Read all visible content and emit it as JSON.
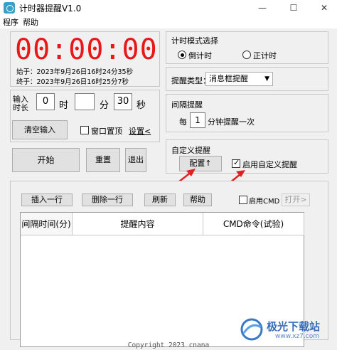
{
  "window": {
    "title": "计时器提醒V1.0",
    "min_glyph": "—",
    "max_glyph": "☐",
    "close_glyph": "✕"
  },
  "menu": {
    "items": [
      "程序",
      "帮助"
    ]
  },
  "clock": {
    "display": "00:00:00",
    "start_line": "始于：2023年9月26日16时24分35秒",
    "end_line": "终于：2023年9月26日16时25分7秒"
  },
  "input": {
    "label_top": "输入",
    "label_bottom": "时长",
    "hours": "0",
    "hours_unit": "时",
    "minutes": "",
    "minutes_unit": "分",
    "seconds": "30",
    "seconds_unit": "秒",
    "clear_label": "清空输入",
    "pin_label": "窗口置顶",
    "settings_link": "设置<"
  },
  "actions": {
    "start": "开始",
    "reset": "重置",
    "exit": "退出"
  },
  "mode": {
    "title": "计时模式选择",
    "countdown": "倒计时",
    "countup": "正计时",
    "countdown_selected": true
  },
  "reminder_type": {
    "label": "提醒类型：",
    "value": "消息框提醒"
  },
  "interval": {
    "title": "间隔提醒",
    "prefix": "每",
    "value": "1",
    "suffix": "分钟提醒一次"
  },
  "custom": {
    "title": "自定义提醒",
    "config_label": "配置↑",
    "enable_label": "启用自定义提醒",
    "enabled": true
  },
  "toolbar": {
    "insert": "插入一行",
    "delete": "删除一行",
    "refresh": "刷新",
    "help": "帮助",
    "enable_cmd": "启用CMD",
    "open": "打开>"
  },
  "table": {
    "columns": [
      "间隔时间(分)",
      "提醒内容",
      "CMD命令(试验)"
    ],
    "rows": []
  },
  "watermark": {
    "text": "极光下载站",
    "url": "www.xz7.com"
  },
  "footer": {
    "copyright": "Copyright 2023 cnana"
  },
  "colors": {
    "clock": "#e81818",
    "arrow": "#e02020",
    "accent": "#3a78c8"
  }
}
